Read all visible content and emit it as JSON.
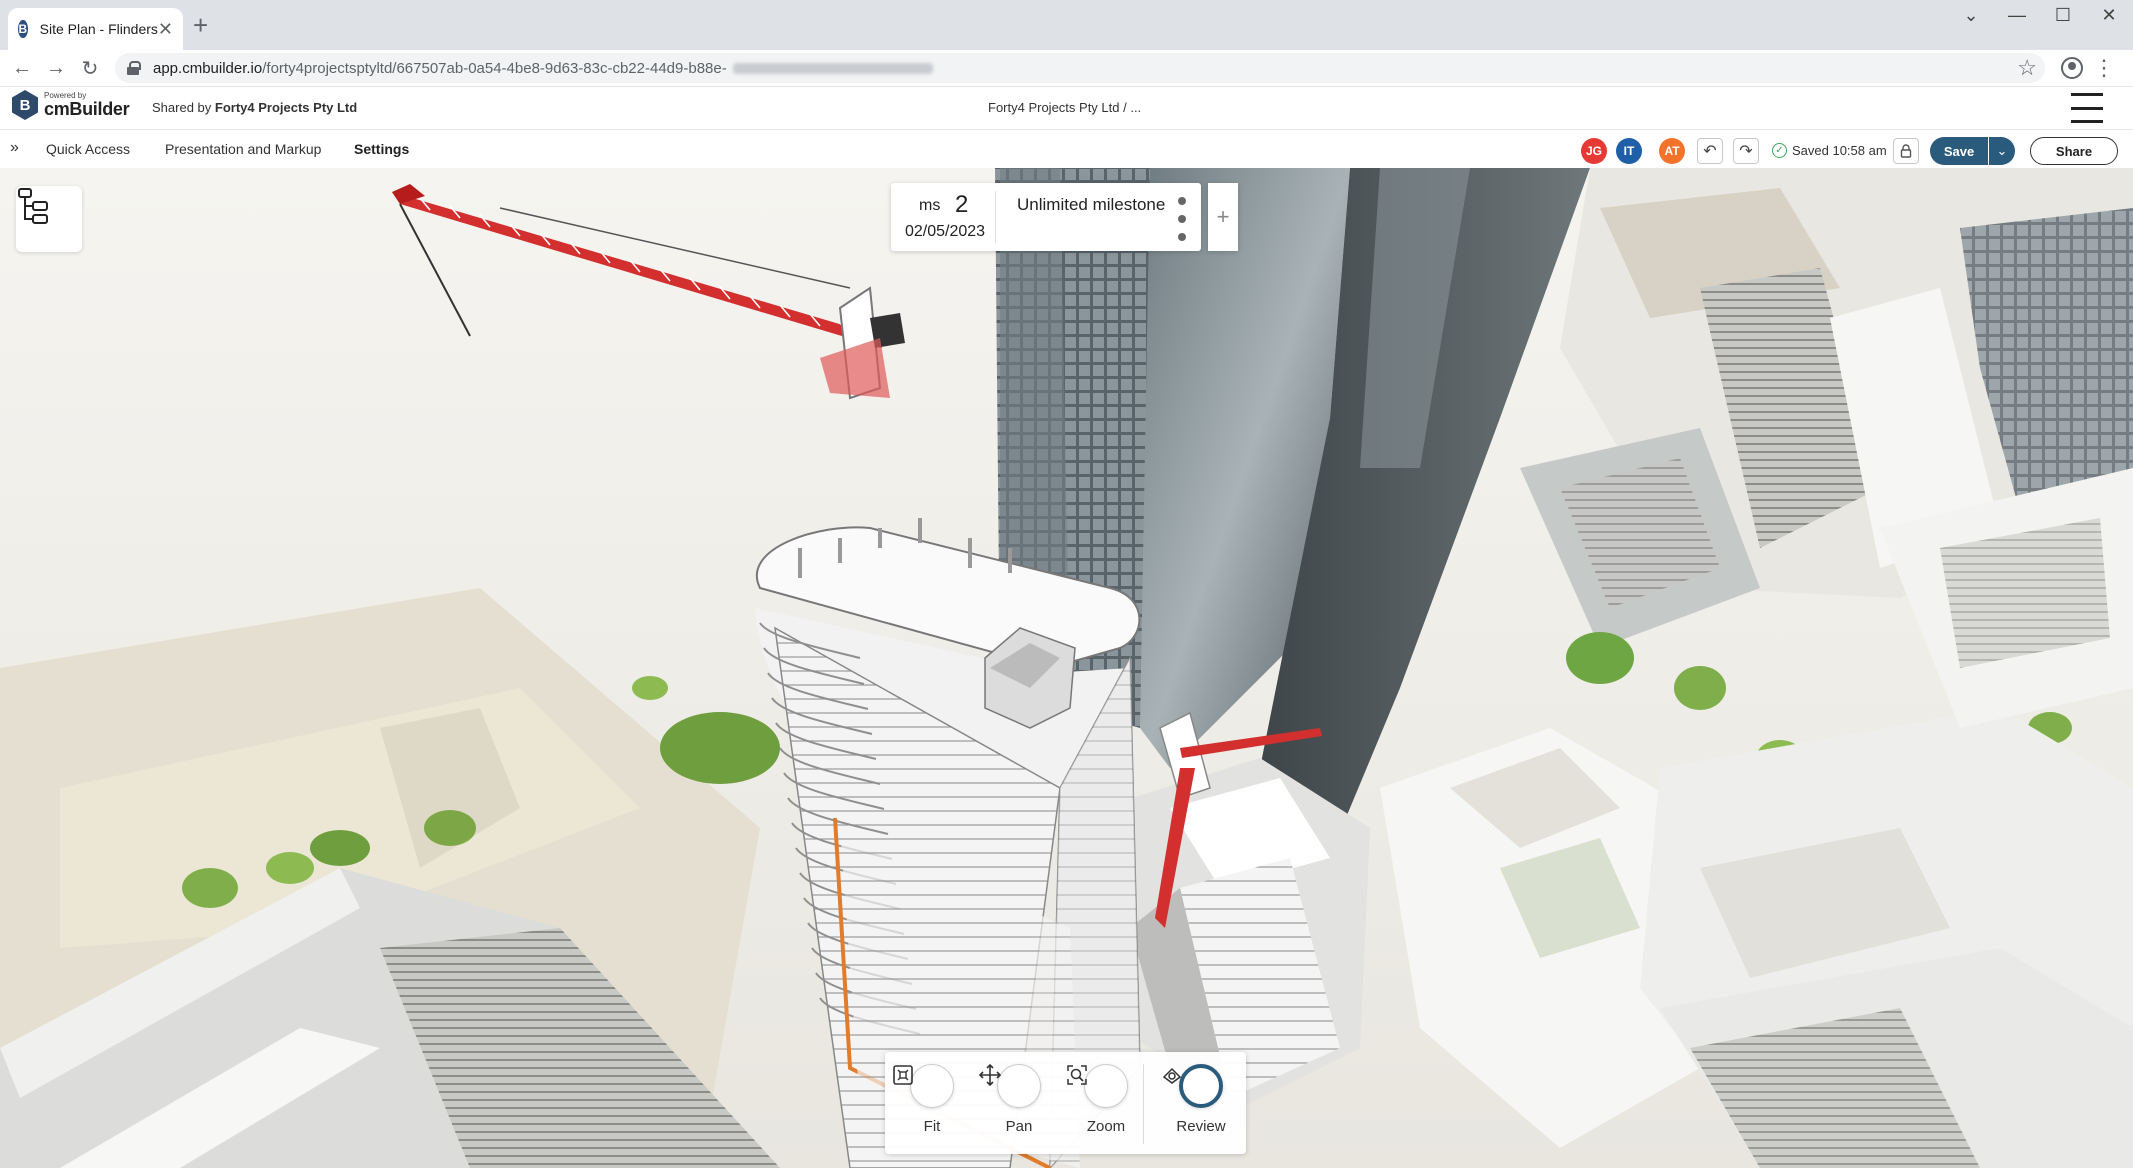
{
  "browser": {
    "tab_title": "Site Plan - Flinders",
    "tab_favicon": "B",
    "url_domain": "app.cmbuilder.io",
    "url_path": "/forty4projectsptyltd/667507ab-0a54-4be8-9d63-83c-cb22-44d9-b88e-"
  },
  "header": {
    "powered_by": "Powered by",
    "brand": "cmBuilder",
    "logo_letter": "B",
    "shared_by_label": "Shared by",
    "shared_by_name": "Forty4 Projects Pty Ltd",
    "project_crumb": "Forty4 Projects Pty Ltd / ..."
  },
  "toolbar": {
    "expander": "»",
    "menu": [
      "Quick Access",
      "Presentation and Markup",
      "Settings"
    ],
    "active_menu": "Settings",
    "avatars": [
      {
        "initials": "JG",
        "color": "#e53935"
      },
      {
        "initials": "IT",
        "color": "#1e5fa8"
      },
      {
        "initials": "AT",
        "color": "#f4732a"
      }
    ],
    "saved_text": "Saved 10:58 am",
    "save_label": "Save",
    "share_label": "Share"
  },
  "milestone": {
    "label": "ms",
    "number": "2",
    "date": "02/05/2023",
    "name": "Unlimited milestone",
    "add": "+"
  },
  "dock": {
    "fit": "Fit",
    "pan": "Pan",
    "zoom": "Zoom",
    "review": "Review"
  },
  "colors": {
    "brand": "#2a5a7c",
    "crane": "#d32f2f"
  }
}
